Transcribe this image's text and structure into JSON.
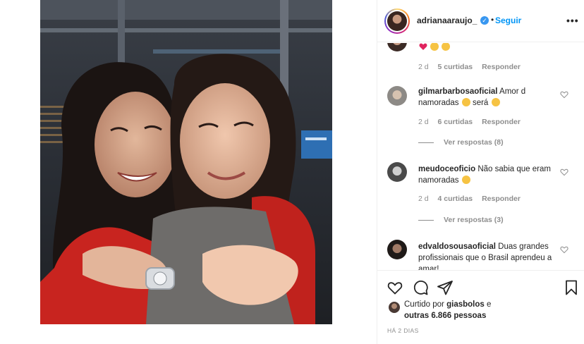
{
  "post": {
    "photo_alt": "",
    "header": {
      "username": "adrianaaraujo_",
      "follow_label": "Seguir",
      "separator": "•",
      "verified_glyph": "✓",
      "more_glyph": "•••"
    },
    "comments": [
      {
        "username": "",
        "text": "",
        "emojis": [
          "heart",
          "smiling-cat",
          "smiling-cat"
        ],
        "time": "2 d",
        "likes": "5 curtidas",
        "reply_label": "Responder"
      },
      {
        "username": "gilmarbarbosaoficial",
        "text": "Amor d namoradas",
        "text_suffix": "será",
        "time": "2 d",
        "likes": "6 curtidas",
        "reply_label": "Responder",
        "view_replies": "Ver respostas (8)"
      },
      {
        "username": "meudoceoficio",
        "text": "Não sabia que eram namoradas",
        "time": "2 d",
        "likes": "4 curtidas",
        "reply_label": "Responder",
        "view_replies": "Ver respostas (3)"
      },
      {
        "username": "edvaldosousaoficial",
        "text": "Duas grandes profissionais que o Brasil aprendeu a amar!"
      }
    ],
    "liked_by": {
      "prefix": "Curtido por",
      "user": "giasbolos",
      "conj": "e",
      "others": "outras 6.866 pessoas"
    },
    "time_ago": "HÁ 2 DIAS"
  },
  "icons": {
    "like": "heart-icon",
    "comment": "comment-icon",
    "share": "share-icon",
    "save": "bookmark-icon",
    "more": "more-options-icon",
    "verified": "verified-badge-icon",
    "comment_like": "heart-outline-icon"
  },
  "colors": {
    "accent_blue": "#0095f6",
    "verified_blue": "#3897f0",
    "muted_text": "#8e8e8e",
    "text": "#262626",
    "divider": "#efefef"
  }
}
